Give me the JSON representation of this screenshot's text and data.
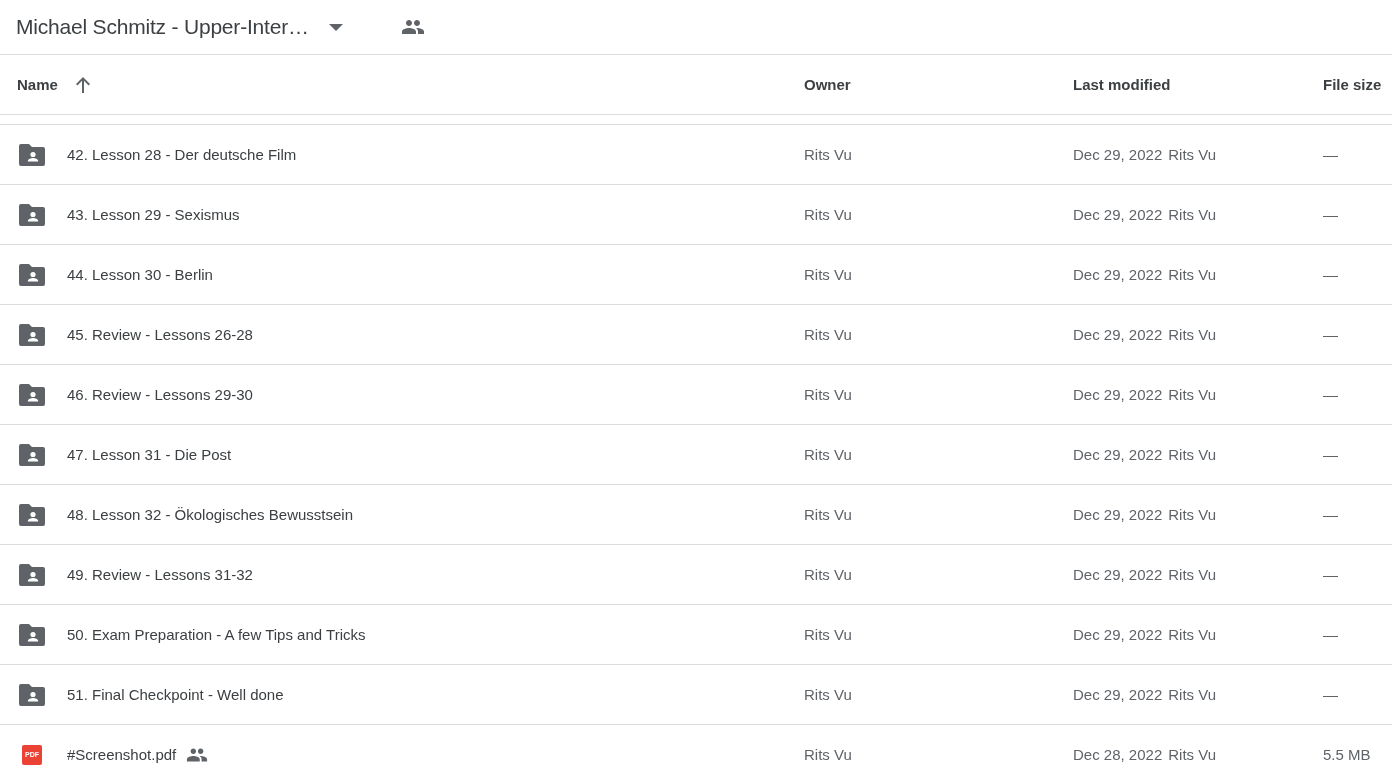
{
  "header": {
    "title": "Michael Schmitz - Upper-Inter…",
    "shared": true
  },
  "table": {
    "columns": [
      {
        "label": "Name",
        "sorted": true
      },
      {
        "label": "Owner",
        "sorted": false
      },
      {
        "label": "Last modified",
        "sorted": false
      },
      {
        "label": "File size",
        "sorted": false
      }
    ],
    "rows": [
      {
        "kind": "folder",
        "name": "42. Lesson 28 - Der deutsche Film",
        "shared": false,
        "owner": "Rits Vu",
        "modified_date": "Dec 29, 2022",
        "modified_by": "Rits Vu",
        "size": "—"
      },
      {
        "kind": "folder",
        "name": "43. Lesson 29 - Sexismus",
        "shared": false,
        "owner": "Rits Vu",
        "modified_date": "Dec 29, 2022",
        "modified_by": "Rits Vu",
        "size": "—"
      },
      {
        "kind": "folder",
        "name": "44. Lesson 30 - Berlin",
        "shared": false,
        "owner": "Rits Vu",
        "modified_date": "Dec 29, 2022",
        "modified_by": "Rits Vu",
        "size": "—"
      },
      {
        "kind": "folder",
        "name": "45. Review - Lessons 26-28",
        "shared": false,
        "owner": "Rits Vu",
        "modified_date": "Dec 29, 2022",
        "modified_by": "Rits Vu",
        "size": "—"
      },
      {
        "kind": "folder",
        "name": "46. Review - Lessons 29-30",
        "shared": false,
        "owner": "Rits Vu",
        "modified_date": "Dec 29, 2022",
        "modified_by": "Rits Vu",
        "size": "—"
      },
      {
        "kind": "folder",
        "name": "47. Lesson 31 - Die Post",
        "shared": false,
        "owner": "Rits Vu",
        "modified_date": "Dec 29, 2022",
        "modified_by": "Rits Vu",
        "size": "—"
      },
      {
        "kind": "folder",
        "name": "48. Lesson 32 - Ökologisches Bewusstsein",
        "shared": false,
        "owner": "Rits Vu",
        "modified_date": "Dec 29, 2022",
        "modified_by": "Rits Vu",
        "size": "—"
      },
      {
        "kind": "folder",
        "name": "49. Review - Lessons 31-32",
        "shared": false,
        "owner": "Rits Vu",
        "modified_date": "Dec 29, 2022",
        "modified_by": "Rits Vu",
        "size": "—"
      },
      {
        "kind": "folder",
        "name": "50. Exam Preparation - A few Tips and Tricks",
        "shared": false,
        "owner": "Rits Vu",
        "modified_date": "Dec 29, 2022",
        "modified_by": "Rits Vu",
        "size": "—"
      },
      {
        "kind": "folder",
        "name": "51. Final Checkpoint - Well done",
        "shared": false,
        "owner": "Rits Vu",
        "modified_date": "Dec 29, 2022",
        "modified_by": "Rits Vu",
        "size": "—"
      },
      {
        "kind": "pdf",
        "icon_text": "PDF",
        "name": "#Screenshot.pdf",
        "shared": true,
        "owner": "Rits Vu",
        "modified_date": "Dec 28, 2022",
        "modified_by": "Rits Vu",
        "size": "5.5 MB"
      }
    ]
  }
}
